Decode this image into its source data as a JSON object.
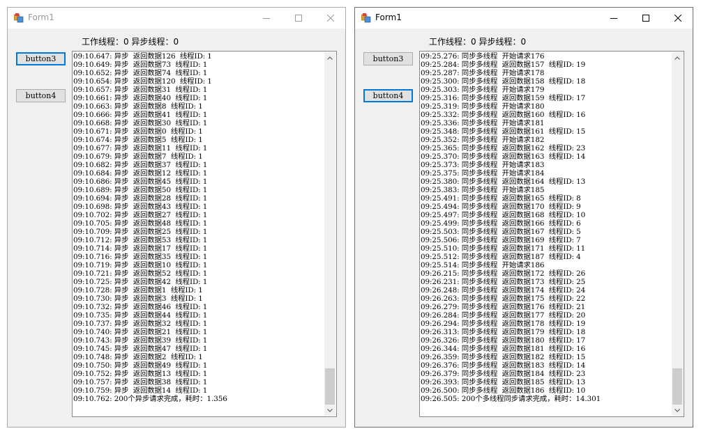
{
  "left_window": {
    "title": "Form1",
    "status": "工作线程：0 异步线程：0",
    "button3": "button3",
    "button4": "button4",
    "lines": [
      "09:10.647: 异步  返回数据126  线程ID: 1",
      "09:10.649: 异步  返回数据73  线程ID: 1",
      "09:10.652: 异步  返回数据74  线程ID: 1",
      "09:10.654: 异步  返回数据120  线程ID: 1",
      "09:10.657: 异步  返回数据31  线程ID: 1",
      "09:10.661: 异步  返回数据40  线程ID: 1",
      "09:10.663: 异步  返回数据8  线程ID: 1",
      "09:10.666: 异步  返回数据41  线程ID: 1",
      "09:10.668: 异步  返回数据30  线程ID: 1",
      "09:10.671: 异步  返回数据0  线程ID: 1",
      "09:10.674: 异步  返回数据5  线程ID: 1",
      "09:10.677: 异步  返回数据11  线程ID: 1",
      "09:10.679: 异步  返回数据7  线程ID: 1",
      "09:10.682: 异步  返回数据37  线程ID: 1",
      "09:10.684: 异步  返回数据12  线程ID: 1",
      "09:10.686: 异步  返回数据45  线程ID: 1",
      "09:10.689: 异步  返回数据50  线程ID: 1",
      "09:10.694: 异步  返回数据28  线程ID: 1",
      "09:10.698: 异步  返回数据43  线程ID: 1",
      "09:10.702: 异步  返回数据27  线程ID: 1",
      "09:10.705: 异步  返回数据48  线程ID: 1",
      "09:10.709: 异步  返回数据25  线程ID: 1",
      "09:10.712: 异步  返回数据53  线程ID: 1",
      "09:10.714: 异步  返回数据17  线程ID: 1",
      "09:10.716: 异步  返回数据35  线程ID: 1",
      "09:10.719: 异步  返回数据10  线程ID: 1",
      "09:10.721: 异步  返回数据52  线程ID: 1",
      "09:10.725: 异步  返回数据42  线程ID: 1",
      "09:10.728: 异步  返回数据1  线程ID: 1",
      "09:10.730: 异步  返回数据3  线程ID: 1",
      "09:10.732: 异步  返回数据46  线程ID: 1",
      "09:10.735: 异步  返回数据44  线程ID: 1",
      "09:10.737: 异步  返回数据32  线程ID: 1",
      "09:10.740: 异步  返回数据21  线程ID: 1",
      "09:10.743: 异步  返回数据39  线程ID: 1",
      "09:10.745: 异步  返回数据47  线程ID: 1",
      "09:10.748: 异步  返回数据2  线程ID: 1",
      "09:10.750: 异步  返回数据49  线程ID: 1",
      "09:10.752: 异步  返回数据13  线程ID: 1",
      "09:10.757: 异步  返回数据38  线程ID: 1",
      "09:10.759: 异步  返回数据14  线程ID: 1",
      "09:10.762: 200个异步请求完成，耗时：1.356"
    ]
  },
  "right_window": {
    "title": "Form1",
    "status": "工作线程：0 异步线程：0",
    "button3": "button3",
    "button4": "button4",
    "lines": [
      "09:25.276: 同步多线程  开始请求176",
      "09:25.284: 同步多线程  返回数据157  线程ID: 19",
      "09:25.287: 同步多线程  开始请求178",
      "09:25.300: 同步多线程  返回数据158  线程ID: 18",
      "09:25.303: 同步多线程  开始请求179",
      "09:25.316: 同步多线程  返回数据159  线程ID: 17",
      "09:25.319: 同步多线程  开始请求180",
      "09:25.332: 同步多线程  返回数据160  线程ID: 16",
      "09:25.336: 同步多线程  开始请求181",
      "09:25.348: 同步多线程  返回数据161  线程ID: 15",
      "09:25.352: 同步多线程  开始请求182",
      "09:25.365: 同步多线程  返回数据162  线程ID: 23",
      "09:25.370: 同步多线程  返回数据163  线程ID: 14",
      "09:25.373: 同步多线程  开始请求183",
      "09:25.375: 同步多线程  开始请求184",
      "09:25.380: 同步多线程  返回数据164  线程ID: 13",
      "09:25.383: 同步多线程  开始请求185",
      "09:25.491: 同步多线程  返回数据165  线程ID: 8",
      "09:25.494: 同步多线程  返回数据170  线程ID: 9",
      "09:25.497: 同步多线程  返回数据168  线程ID: 10",
      "09:25.499: 同步多线程  返回数据166  线程ID: 6",
      "09:25.503: 同步多线程  返回数据167  线程ID: 5",
      "09:25.506: 同步多线程  返回数据169  线程ID: 7",
      "09:25.510: 同步多线程  返回数据171  线程ID: 11",
      "09:25.512: 同步多线程  返回数据187  线程ID: 4",
      "09:25.514: 同步多线程  开始请求186",
      "09:26.215: 同步多线程  返回数据172  线程ID: 26",
      "09:26.231: 同步多线程  返回数据173  线程ID: 25",
      "09:26.248: 同步多线程  返回数据174  线程ID: 24",
      "09:26.263: 同步多线程  返回数据175  线程ID: 22",
      "09:26.279: 同步多线程  返回数据176  线程ID: 21",
      "09:26.284: 同步多线程  返回数据177  线程ID: 20",
      "09:26.294: 同步多线程  返回数据178  线程ID: 19",
      "09:26.313: 同步多线程  返回数据179  线程ID: 18",
      "09:26.326: 同步多线程  返回数据180  线程ID: 17",
      "09:26.344: 同步多线程  返回数据181  线程ID: 16",
      "09:26.359: 同步多线程  返回数据182  线程ID: 15",
      "09:26.376: 同步多线程  返回数据183  线程ID: 14",
      "09:26.379: 同步多线程  返回数据184  线程ID: 23",
      "09:26.393: 同步多线程  返回数据185  线程ID: 13",
      "09:26.500: 同步多线程  返回数据186  线程ID: 10",
      "09:26.505: 200个多线程同步请求完成，耗时：14.301"
    ]
  },
  "icons": {
    "app": "form-app-icon",
    "minimize": "minimize-icon",
    "maximize": "maximize-icon",
    "close": "close-icon",
    "scroll_up": "scroll-up-arrow-icon",
    "scroll_down": "scroll-down-arrow-icon"
  },
  "colors": {
    "focus_border": "#0078d7",
    "button_bg": "#e1e1e1",
    "window_bg": "#f0f0f0",
    "inactive_title": "#9a9a9a"
  }
}
